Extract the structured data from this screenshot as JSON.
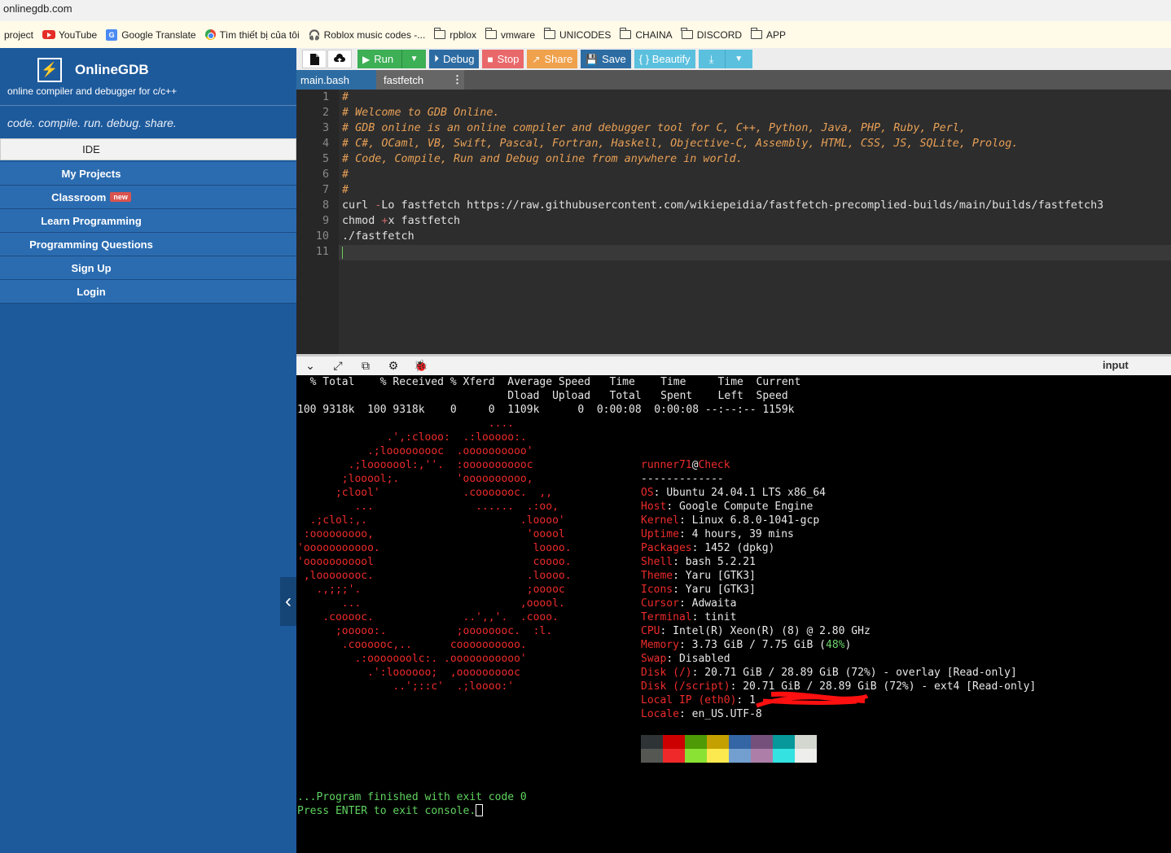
{
  "browser": {
    "url": "onlinegdb.com",
    "bookmarks": [
      "project",
      "YouTube",
      "Google Translate",
      "Tìm thiết bị của tôi",
      "Roblox music codes -...",
      "rpblox",
      "vmware",
      "UNICODES",
      "CHAINA",
      "DISCORD",
      "APP"
    ]
  },
  "sidebar": {
    "logo_glyph": "⚡",
    "brand": "OnlineGDB",
    "tagline": "online compiler and debugger for c/c++",
    "slogan": "code. compile. run. debug. share.",
    "menu": [
      "IDE",
      "My Projects",
      "Classroom",
      "Learn Programming",
      "Programming Questions",
      "Sign Up",
      "Login"
    ],
    "classroom_badge": "new",
    "collapse_icon": "‹"
  },
  "toolbar": {
    "run": "Run",
    "debug": "Debug",
    "stop": "Stop",
    "share": "Share",
    "save": "Save",
    "beautify": "{ } Beautify"
  },
  "tabs": [
    "main.bash",
    "fastfetch"
  ],
  "tab_more": "⋮",
  "editor": {
    "line_numbers": [
      "1",
      "2",
      "3",
      "4",
      "5",
      "6",
      "7",
      "8",
      "9",
      "10",
      "11"
    ],
    "comments": [
      "#",
      "# Welcome to GDB Online.",
      "# GDB online is an online compiler and debugger tool for C, C++, Python, Java, PHP, Ruby, Perl,",
      "# C#, OCaml, VB, Swift, Pascal, Fortran, Haskell, Objective-C, Assembly, HTML, CSS, JS, SQLite, Prolog.",
      "# Code, Compile, Run and Debug online from anywhere in world.",
      "#",
      "#"
    ],
    "line8_cmd": "curl ",
    "line8_flag": "-",
    "line8_rest": "Lo fastfetch https:",
    "line8_url": "//raw.githubusercontent.com/wikiepeidia/fastfetch-precomplied-builds/main/builds/fastfetch3",
    "line9_a": "chmod ",
    "line9_op": "+",
    "line9_b": "x fastfetch",
    "line10": "./fastfetch"
  },
  "output": {
    "input_label": "input",
    "curl_header1": "  % Total    % Received % Xferd  Average Speed   Time    Time     Time  Current",
    "curl_header2": "                                 Dload  Upload   Total   Spent    Left  Speed",
    "curl_stats": "100 9318k  100 9318k    0     0  1109k      0  0:00:08  0:00:08 --:--:-- 1159k",
    "logo_lines": [
      "                              ....",
      "              .',:clooo:  .:looooo:.",
      "           .;looooooooc  .oooooooooo'",
      "        .;looooool:,''.  :ooooooooooc",
      "       ;looool;.         'oooooooooo,",
      "      ;clool'             .cooooooc.  ,,",
      "         ...                ......  .:oo,",
      "  .;clol:,.                        .loooo'",
      " :ooooooooo,                        'ooool",
      "'ooooooooooo.                        loooo.",
      "'ooooooooool                         coooo.",
      " ,loooooooc.                        .loooo.",
      "   .,;;;'.                          ;ooooc",
      "       ...                         ,ooool.",
      "    .cooooc.              ..',,'.  .cooo.",
      "      ;ooooo:.           ;oooooooc.  :l.",
      "       .coooooc,..      coooooooooo.",
      "         .:ooooooolc:. .ooooooooooo'",
      "           .':loooooo;  ,oooooooooc",
      "               ..';::c'  .;loooo:'"
    ],
    "user": "runner71",
    "at": "@",
    "host": "Check",
    "separator": "-------------",
    "info": [
      {
        "key": "OS",
        "value": "Ubuntu 24.04.1 LTS x86_64"
      },
      {
        "key": "Host",
        "value": "Google Compute Engine"
      },
      {
        "key": "Kernel",
        "value": "Linux 6.8.0-1041-gcp"
      },
      {
        "key": "Uptime",
        "value": "4 hours, 39 mins"
      },
      {
        "key": "Packages",
        "value": "1452 (dpkg)"
      },
      {
        "key": "Shell",
        "value": "bash 5.2.21"
      },
      {
        "key": "Theme",
        "value": "Yaru [GTK3]"
      },
      {
        "key": "Icons",
        "value": "Yaru [GTK3]"
      },
      {
        "key": "Cursor",
        "value": "Adwaita"
      },
      {
        "key": "Terminal",
        "value": "tinit"
      }
    ],
    "cpu_key": "CPU",
    "cpu_value": "Intel(R) Xeon(R) (8) @ 2.80 GHz",
    "memory_key": "Memory",
    "memory_value": "3.73 GiB / 7.75 GiB (",
    "memory_pct": "48%",
    "memory_close": ")",
    "swap_key": "Swap",
    "swap_value": "Disabled",
    "disk1_key": "Disk (/)",
    "disk1_value": "20.71 GiB / 28.89 GiB (72%) - overlay [Read-only]",
    "disk2_key": "Disk (/script)",
    "disk2_value": "20.71 GiB / 28.89 GiB (72%) - ext4 [Read-only]",
    "ip_key": "Local IP (eth0)",
    "ip_value": "1",
    "locale_key": "Locale",
    "locale_value": "en_US.UTF-8",
    "palette_top": [
      "#2e3436",
      "#cc0000",
      "#4e9a06",
      "#c4a000",
      "#3465a4",
      "#75507b",
      "#06989a",
      "#d3d7cf"
    ],
    "palette_bottom": [
      "#555753",
      "#ef2929",
      "#8ae234",
      "#fce94f",
      "#729fcf",
      "#ad7fa8",
      "#34e2e2",
      "#eeeeec"
    ],
    "finished": "...Program finished with exit code 0",
    "press_enter": "Press ENTER to exit console."
  },
  "colors": {
    "sidebar": "#1d5a9c",
    "run": "#3daf55",
    "debug": "#2d6ca2",
    "stop": "#e9686a",
    "share": "#f0a14b",
    "beautify": "#5bc0de",
    "terminal_red": "#ee2b2b",
    "terminal_green": "#5fd35f"
  }
}
